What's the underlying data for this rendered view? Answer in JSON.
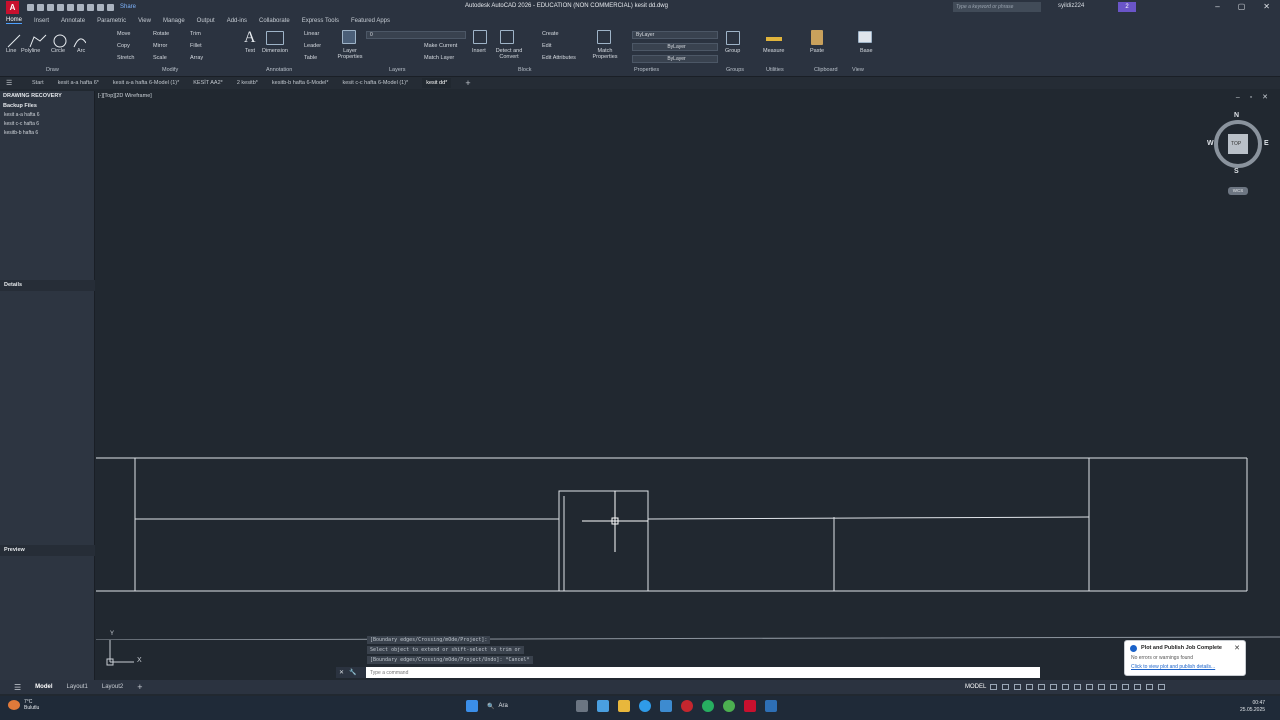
{
  "title_bar": {
    "logo": "A",
    "share_label": "Share",
    "title": "Autodesk AutoCAD 2026 - EDUCATION (NON COMMERCIAL)   kesit dd.dwg",
    "search_placeholder": "Type a keyword or phrase",
    "user": "syildiz224",
    "notification_badge": "2"
  },
  "ribbon_tabs": [
    "Home",
    "Insert",
    "Annotate",
    "Parametric",
    "View",
    "Manage",
    "Output",
    "Add-ins",
    "Collaborate",
    "Express Tools",
    "Featured Apps"
  ],
  "ribbon": {
    "draw": {
      "title": "Draw",
      "tools": [
        "Line",
        "Polyline",
        "Circle",
        "Arc"
      ]
    },
    "modify": {
      "title": "Modify",
      "tools": [
        "Move",
        "Rotate",
        "Trim",
        "Copy",
        "Mirror",
        "Fillet",
        "Stretch",
        "Scale",
        "Array"
      ]
    },
    "annotation": {
      "title": "Annotation",
      "tools": [
        "Text",
        "Dimension",
        "Linear",
        "Leader",
        "Table"
      ]
    },
    "layers": {
      "title": "Layers",
      "tools": [
        "Layer Properties",
        "Make Current",
        "Match Layer"
      ],
      "current_layer": "0"
    },
    "block": {
      "title": "Block",
      "tools": [
        "Insert",
        "Detect and Convert",
        "Create",
        "Edit",
        "Edit Attributes"
      ]
    },
    "properties": {
      "title": "Properties",
      "tools": [
        "Match Properties"
      ],
      "color": "ByLayer",
      "linetype": "ByLayer",
      "lineweight": "ByLayer"
    },
    "groups": {
      "title": "Groups",
      "tools": [
        "Group"
      ]
    },
    "utilities": {
      "title": "Utilities",
      "tools": [
        "Measure"
      ]
    },
    "clipboard": {
      "title": "Clipboard",
      "tools": [
        "Paste"
      ]
    },
    "view": {
      "title": "View",
      "tools": [
        "Base"
      ]
    }
  },
  "file_tabs": [
    "Start",
    "kesit a-a hafta 6*",
    "kesit a-a hafta 6-Model (1)*",
    "KESİT AA2*",
    "2 kesitb*",
    "kesitb-b hafta 6-Model*",
    "kesit c-c hafta 6-Model (1)*",
    "kesit dd*"
  ],
  "palette": {
    "header": "DRAWING RECOVERY",
    "backup_label": "Backup Files",
    "files": [
      "kesit a-a hafta 6",
      "kesit c-c hafta 6",
      "kesitb-b hafta 6"
    ],
    "details_label": "Details",
    "preview_label": "Preview"
  },
  "viewport": {
    "label": "[-][Top][2D Wireframe]",
    "navcube": {
      "top": "TOP",
      "n": "N",
      "s": "S",
      "e": "E",
      "w": "W",
      "ucs": "WCS"
    },
    "ucs_x": "X",
    "ucs_y": "Y"
  },
  "command": {
    "history": [
      "[Boundary edges/Crossing/mOde/Project]:",
      "Select object to extend or shift-select to trim or",
      "[Boundary edges/Crossing/mOde/Project/Undo]: *Cancel*"
    ],
    "placeholder": "Type a command"
  },
  "notification": {
    "title": "Plot and Publish Job Complete",
    "body": "No errors or warnings found",
    "link": "Click to view plot and publish details..."
  },
  "statusbar": {
    "layout_tabs": [
      "Model",
      "Layout1",
      "Layout2"
    ],
    "model_label": "MODEL"
  },
  "taskbar": {
    "weather_temp": "7°C",
    "weather_text": "Bulutlu",
    "search_label": "Ara",
    "time": "00:47",
    "date": "25.05.2025"
  }
}
